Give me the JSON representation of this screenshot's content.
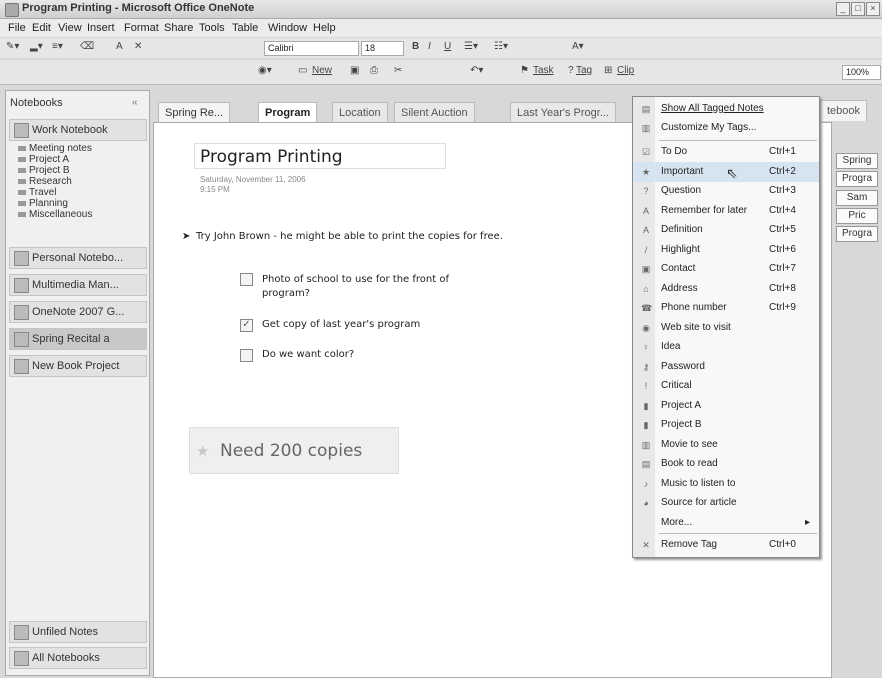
{
  "window": {
    "title": "Program Printing - Microsoft Office OneNote"
  },
  "menus": [
    "File",
    "Edit",
    "View",
    "Insert",
    "Format",
    "Share",
    "Tools",
    "Table",
    "Window",
    "Help"
  ],
  "toolbar": {
    "font": "Calibri",
    "size": "18",
    "new_label": "New",
    "task_label": "Task",
    "tag_label": "Tag",
    "clip_label": "Clip",
    "zoom": "100%",
    "notebook_search": "tebook"
  },
  "nav": {
    "header": "Notebooks",
    "notebooks": [
      {
        "label": "Work Notebook"
      },
      {
        "label": "Personal Notebo..."
      },
      {
        "label": "Multimedia Man..."
      },
      {
        "label": "OneNote 2007 G..."
      },
      {
        "label": "Spring Recital a"
      },
      {
        "label": "New Book Project"
      }
    ],
    "sections": [
      "Meeting notes",
      "Project A",
      "Project B",
      "Research",
      "Travel",
      "Planning",
      "Miscellaneous"
    ],
    "unfiled": "Unfiled Notes",
    "all": "All Notebooks"
  },
  "tabs": {
    "notebook": "Spring Re...",
    "items": [
      "Program",
      "Location",
      "Silent Auction",
      "Last Year's Progr..."
    ]
  },
  "page": {
    "title": "Program Printing",
    "date": "Saturday, November 11, 2006",
    "time": "9:15 PM",
    "bullet": "Try John Brown - he might be able to print the copies for free.",
    "todos": [
      {
        "text": "Photo of school to use for the front of program?",
        "checked": false
      },
      {
        "text": "Get copy of last year's program",
        "checked": true
      },
      {
        "text": "Do we want color?",
        "checked": false
      }
    ],
    "callout": "Need 200 copies"
  },
  "right_tabs": [
    "Spring",
    "Progra",
    "Sam",
    "Pric",
    "Progra"
  ],
  "tag_menu": {
    "top": [
      {
        "label": "Show All Tagged Notes"
      },
      {
        "label": "Customize My Tags..."
      }
    ],
    "items": [
      {
        "label": "To Do",
        "shortcut": "Ctrl+1",
        "icon": "checkbox-icon"
      },
      {
        "label": "Important",
        "shortcut": "Ctrl+2",
        "icon": "star-icon"
      },
      {
        "label": "Question",
        "shortcut": "Ctrl+3",
        "icon": "question-icon"
      },
      {
        "label": "Remember for later",
        "shortcut": "Ctrl+4",
        "icon": "highlight-a-icon"
      },
      {
        "label": "Definition",
        "shortcut": "Ctrl+5",
        "icon": "highlight-a-icon"
      },
      {
        "label": "Highlight",
        "shortcut": "Ctrl+6",
        "icon": "highlighter-icon"
      },
      {
        "label": "Contact",
        "shortcut": "Ctrl+7",
        "icon": "contact-icon"
      },
      {
        "label": "Address",
        "shortcut": "Ctrl+8",
        "icon": "house-icon"
      },
      {
        "label": "Phone number",
        "shortcut": "Ctrl+9",
        "icon": "phone-icon"
      },
      {
        "label": "Web site to visit",
        "shortcut": "",
        "icon": "globe-icon"
      },
      {
        "label": "Idea",
        "shortcut": "",
        "icon": "lightbulb-icon"
      },
      {
        "label": "Password",
        "shortcut": "",
        "icon": "key-icon"
      },
      {
        "label": "Critical",
        "shortcut": "",
        "icon": "exclamation-icon"
      },
      {
        "label": "Project A",
        "shortcut": "",
        "icon": "flag-icon"
      },
      {
        "label": "Project B",
        "shortcut": "",
        "icon": "flag-icon"
      },
      {
        "label": "Movie to see",
        "shortcut": "",
        "icon": "film-icon"
      },
      {
        "label": "Book to read",
        "shortcut": "",
        "icon": "book-icon"
      },
      {
        "label": "Music to listen to",
        "shortcut": "",
        "icon": "music-icon"
      },
      {
        "label": "Source for article",
        "shortcut": "",
        "icon": "source-icon"
      },
      {
        "label": "More...",
        "shortcut": "",
        "icon": ""
      }
    ],
    "remove": {
      "label": "Remove Tag",
      "shortcut": "Ctrl+0"
    }
  }
}
